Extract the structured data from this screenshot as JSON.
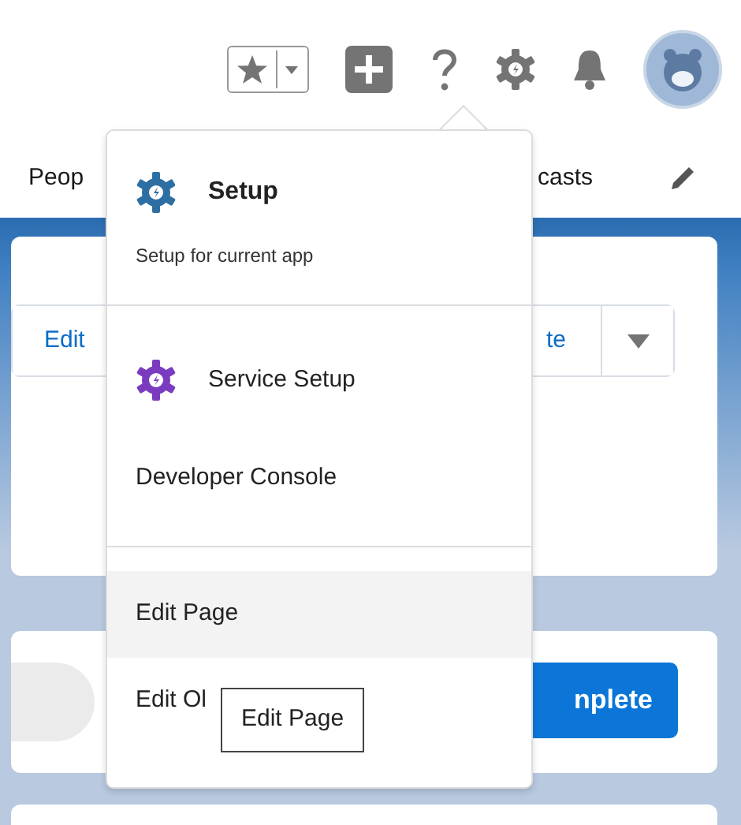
{
  "header": {
    "favorites_on": false
  },
  "nav": {
    "items": [
      "Peop",
      "casts"
    ]
  },
  "record_card": {
    "buttons": [
      "Edit",
      "te"
    ]
  },
  "path_card": {
    "button": "nplete"
  },
  "setup_menu": {
    "open": true,
    "sections": [
      {
        "items": [
          {
            "kind": "primary_app",
            "label": "Setup",
            "description": "Setup for current app",
            "color": "#2e6fa3",
            "highlighted": false
          }
        ]
      },
      {
        "items": [
          {
            "kind": "app",
            "label": "Service Setup",
            "color": "#7b3bbf",
            "highlighted": false
          },
          {
            "kind": "link",
            "label": "Developer Console",
            "highlighted": false
          }
        ]
      },
      {
        "items": [
          {
            "kind": "link",
            "label": "Edit Page",
            "highlighted": true
          },
          {
            "kind": "link",
            "label": "Edit Ol",
            "highlighted": false
          }
        ]
      }
    ]
  },
  "tooltip": {
    "text": "Edit Page"
  }
}
